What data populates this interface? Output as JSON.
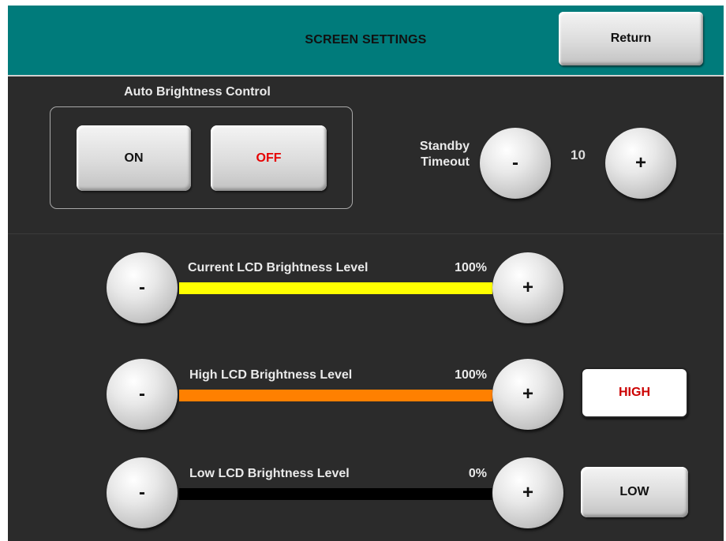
{
  "header": {
    "title": "SCREEN SETTINGS",
    "return_label": "Return",
    "color": "#007b7b"
  },
  "auto_brightness": {
    "label": "Auto Brightness Control",
    "on_label": "ON",
    "off_label": "OFF",
    "selected": "OFF"
  },
  "standby": {
    "label_line1": "Standby",
    "label_line2": "Timeout",
    "minus_label": "-",
    "plus_label": "+",
    "value": "10"
  },
  "sliders": [
    {
      "label": "Current LCD Brightness Level",
      "percent_text": "100%",
      "level": 100,
      "color": "#ffff00",
      "minus_label": "-",
      "plus_label": "+"
    },
    {
      "label": "High LCD Brightness Level",
      "percent_text": "100%",
      "level": 100,
      "color": "#ff8000",
      "minus_label": "-",
      "plus_label": "+"
    },
    {
      "label": "Low LCD Brightness Level",
      "percent_text": "0%",
      "level": 0,
      "color": "#000000",
      "minus_label": "-",
      "plus_label": "+"
    }
  ],
  "modes": {
    "high_label": "HIGH",
    "low_label": "LOW",
    "active": "HIGH",
    "active_text_color": "#cc0000"
  }
}
